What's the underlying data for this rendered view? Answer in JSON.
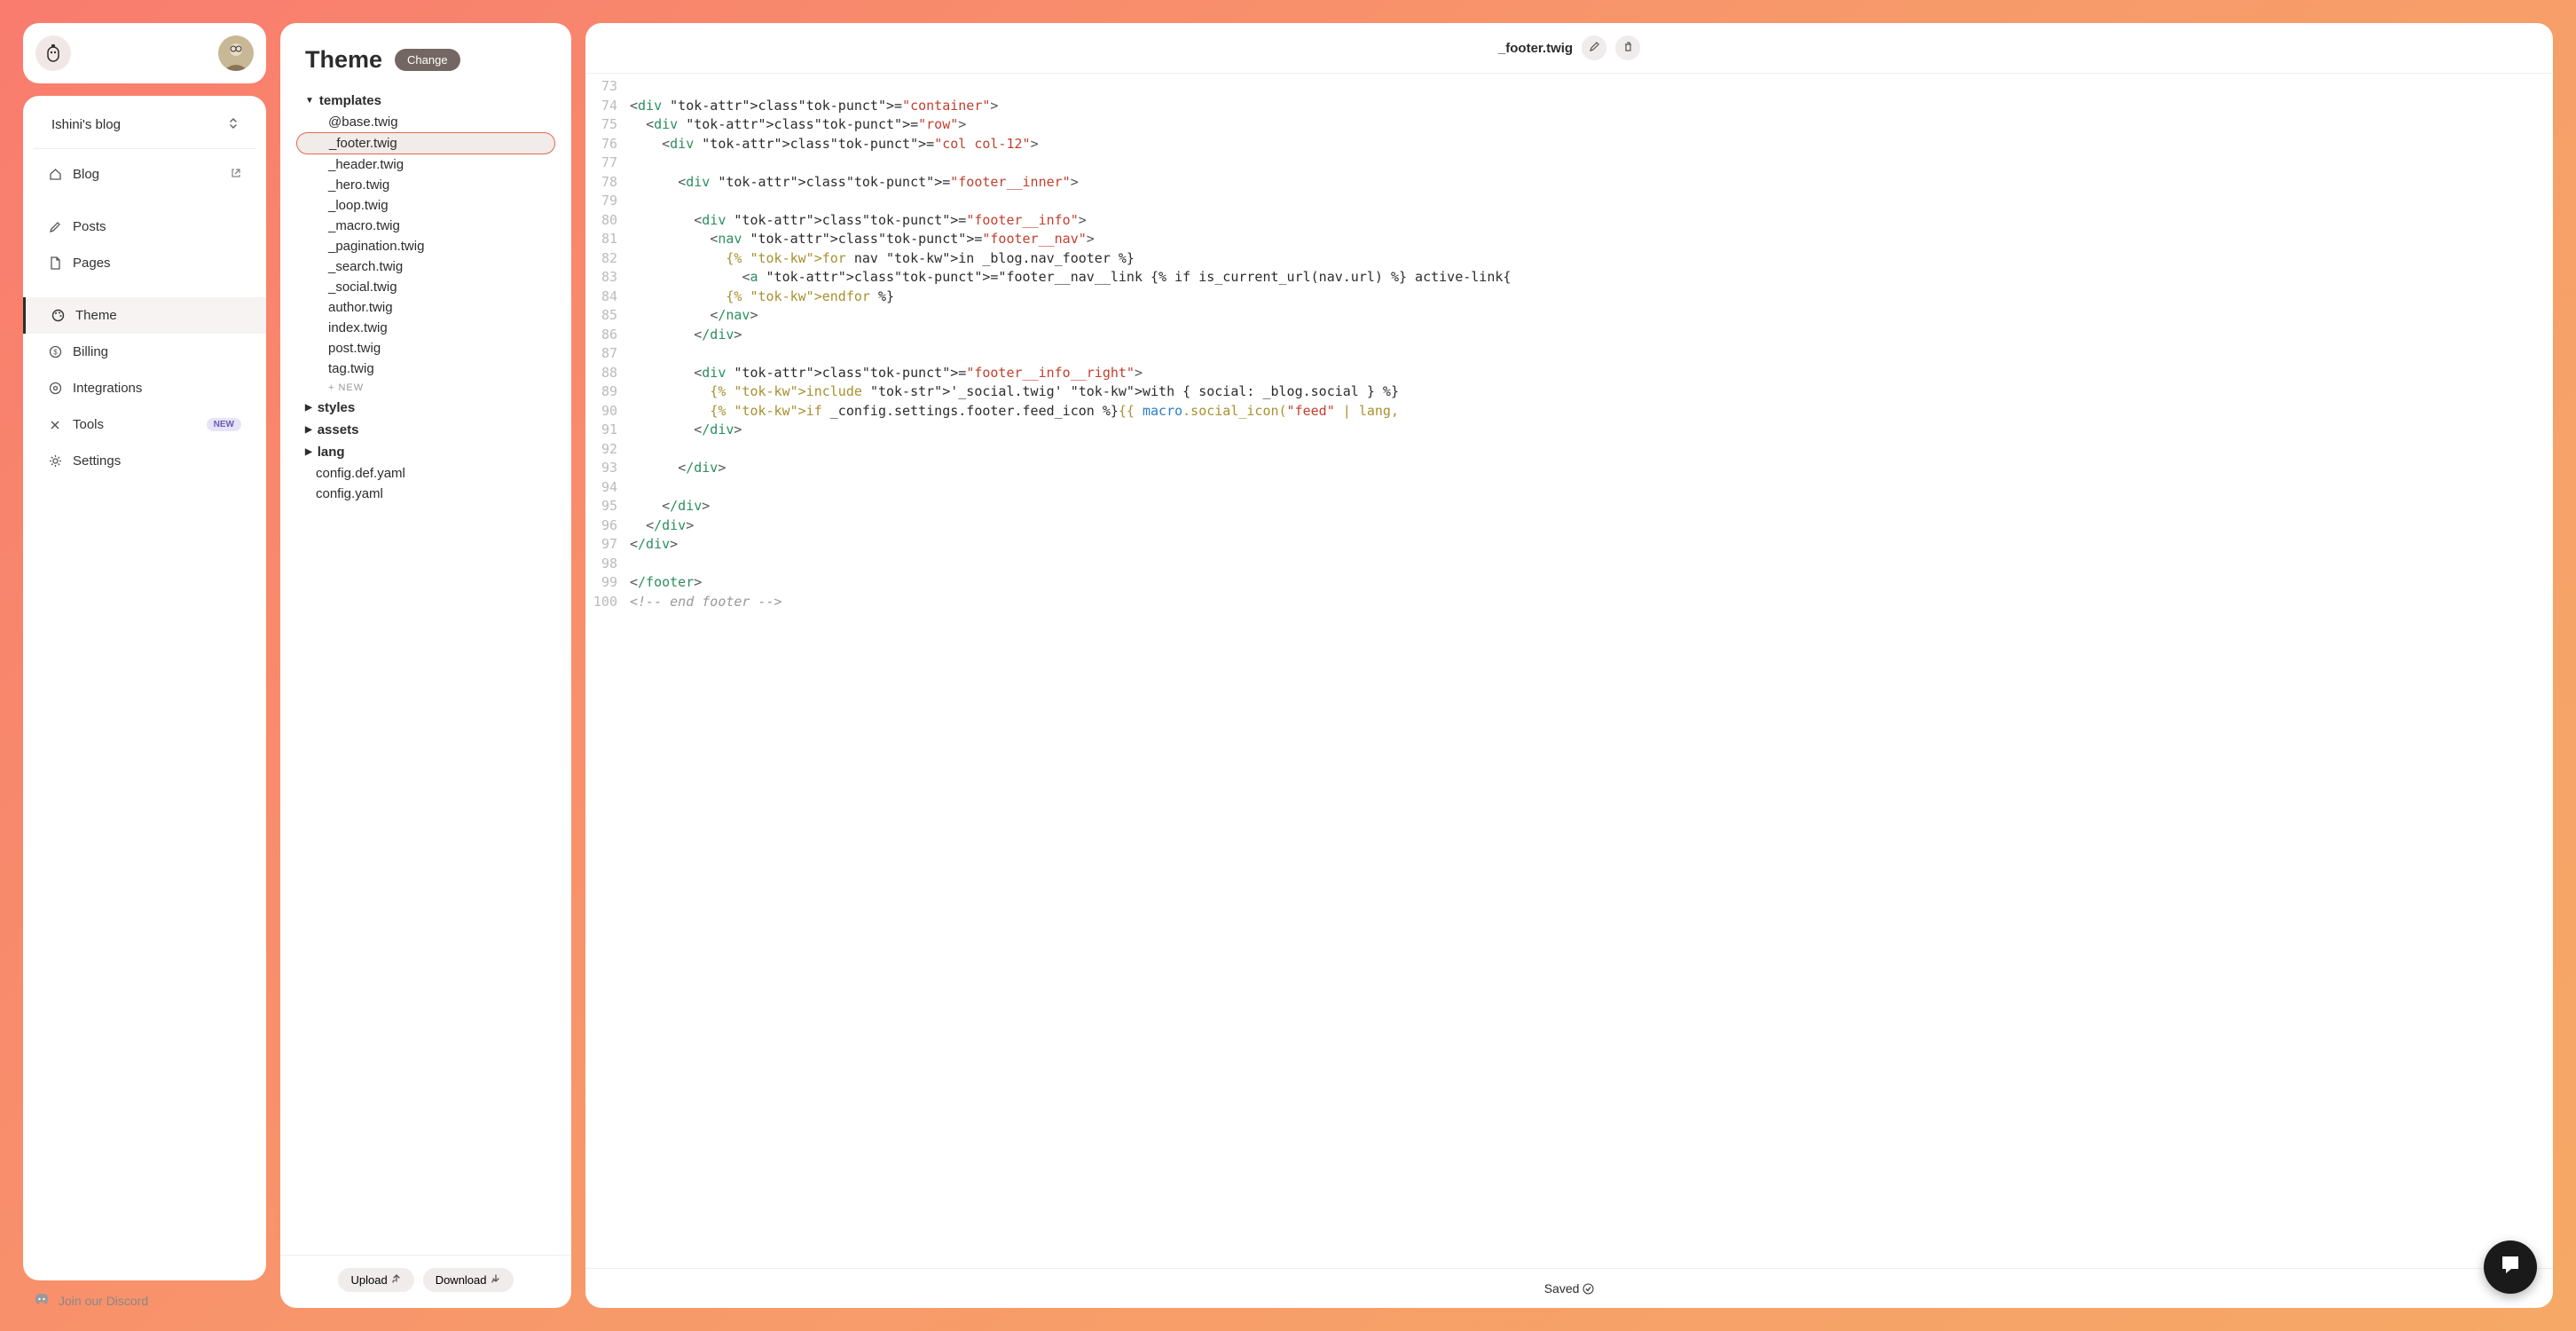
{
  "sidebar": {
    "blog_name": "Ishini's blog",
    "nav": {
      "blog": "Blog",
      "posts": "Posts",
      "pages": "Pages",
      "theme": "Theme",
      "billing": "Billing",
      "integrations": "Integrations",
      "tools": "Tools",
      "tools_badge": "NEW",
      "settings": "Settings"
    },
    "discord": "Join our Discord"
  },
  "tree": {
    "title": "Theme",
    "change": "Change",
    "folders": {
      "templates": "templates",
      "styles": "styles",
      "assets": "assets",
      "lang": "lang"
    },
    "templates": [
      "@base.twig",
      "_footer.twig",
      "_header.twig",
      "_hero.twig",
      "_loop.twig",
      "_macro.twig",
      "_pagination.twig",
      "_search.twig",
      "_social.twig",
      "author.twig",
      "index.twig",
      "post.twig",
      "tag.twig"
    ],
    "new_label": "+  NEW",
    "root_files": [
      "config.def.yaml",
      "config.yaml"
    ],
    "upload": "Upload",
    "download": "Download"
  },
  "editor": {
    "filename": "_footer.twig",
    "saved": "Saved",
    "lines": [
      {
        "n": 73,
        "raw": ""
      },
      {
        "n": 74,
        "raw": "<div class=\"container\">"
      },
      {
        "n": 75,
        "raw": "  <div class=\"row\">"
      },
      {
        "n": 76,
        "raw": "    <div class=\"col col-12\">"
      },
      {
        "n": 77,
        "raw": ""
      },
      {
        "n": 78,
        "raw": "      <div class=\"footer__inner\">"
      },
      {
        "n": 79,
        "raw": ""
      },
      {
        "n": 80,
        "raw": "        <div class=\"footer__info\">"
      },
      {
        "n": 81,
        "raw": "          <nav class=\"footer__nav\">"
      },
      {
        "n": 82,
        "raw": "            {% for nav in _blog.nav_footer %}"
      },
      {
        "n": 83,
        "raw": "              <a class=\"footer__nav__link {% if is_current_url(nav.url) %} active-link{"
      },
      {
        "n": 84,
        "raw": "            {% endfor %}"
      },
      {
        "n": 85,
        "raw": "          </nav>"
      },
      {
        "n": 86,
        "raw": "        </div>"
      },
      {
        "n": 87,
        "raw": ""
      },
      {
        "n": 88,
        "raw": "        <div class=\"footer__info__right\">"
      },
      {
        "n": 89,
        "raw": "          {% include '_social.twig' with { social: _blog.social } %}"
      },
      {
        "n": 90,
        "raw": "          {% if _config.settings.footer.feed_icon %}{{ macro.social_icon(\"feed\" | lang,"
      },
      {
        "n": 91,
        "raw": "        </div>"
      },
      {
        "n": 92,
        "raw": ""
      },
      {
        "n": 93,
        "raw": "      </div>"
      },
      {
        "n": 94,
        "raw": ""
      },
      {
        "n": 95,
        "raw": "    </div>"
      },
      {
        "n": 96,
        "raw": "  </div>"
      },
      {
        "n": 97,
        "raw": "</div>"
      },
      {
        "n": 98,
        "raw": ""
      },
      {
        "n": 99,
        "raw": "</footer>"
      },
      {
        "n": 100,
        "raw": "<!-- end footer -->"
      }
    ]
  }
}
